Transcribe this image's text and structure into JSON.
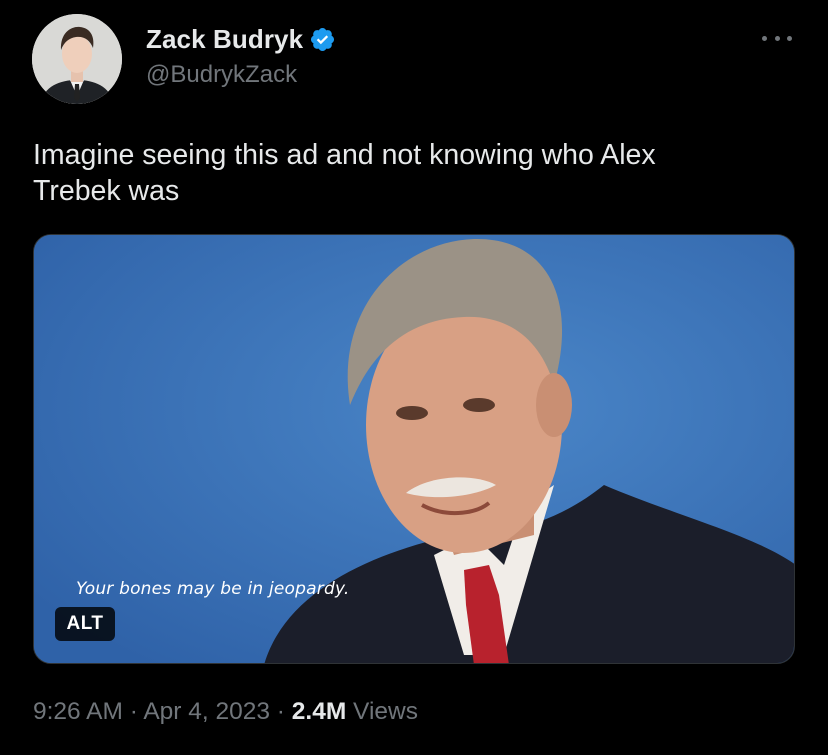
{
  "tweet": {
    "author": {
      "display_name": "Zack Budryk",
      "handle": "@BudrykZack",
      "verified": true,
      "verified_icon": "verified-badge-icon",
      "verified_color": "#1d9bf0"
    },
    "more_icon": "more-options-icon",
    "text": "Imagine seeing this ad and not knowing who Alex\nTrebek was",
    "media": {
      "caption": "Your bones may be in jeopardy.",
      "alt_badge": "ALT",
      "background_color": "#3c73b8"
    },
    "meta": {
      "time": "9:26 AM",
      "separator1": " · ",
      "date": "Apr 4, 2023",
      "separator2": " · ",
      "views_count": "2.4M",
      "views_label": " Views"
    }
  },
  "colors": {
    "background": "#000000",
    "primary_text": "#e7e9ea",
    "secondary_text": "#71767b"
  }
}
